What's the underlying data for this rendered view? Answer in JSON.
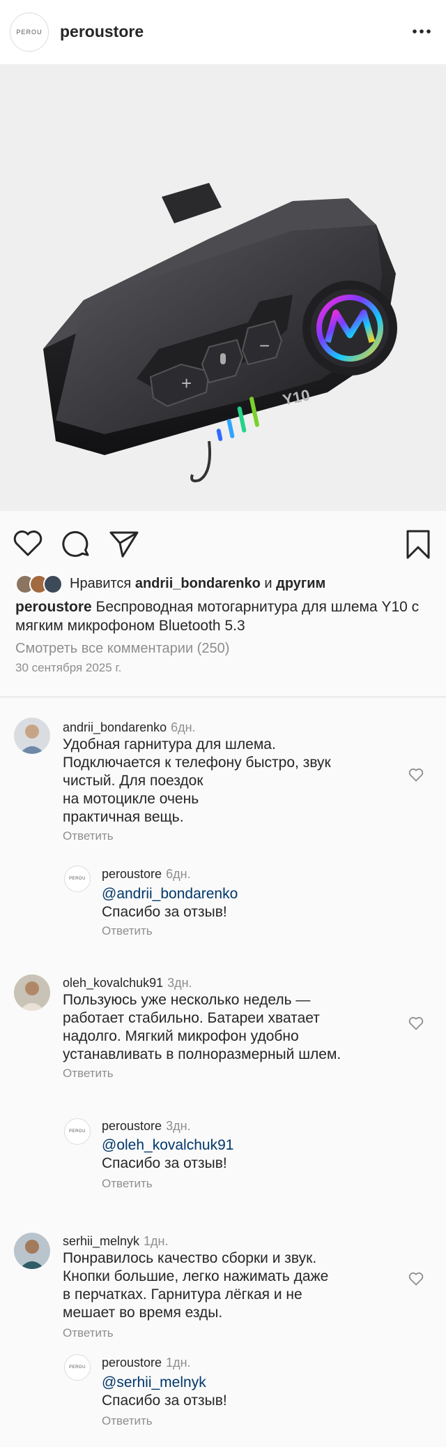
{
  "header": {
    "logo_text": "PEROU",
    "username": "peroustore"
  },
  "post": {
    "likes_prefix": "Нравится",
    "likes_user": "andrii_bondarenko",
    "likes_and": "и",
    "likes_others": "другим",
    "caption_user": "peroustore",
    "caption_text": "Беспроводная мотогарнитура для шлема Y10 с мягким микрофоном Bluetooth 5.3",
    "view_all": "Смотреть все комментарии (250)",
    "date": "30 сентября 2025 г.",
    "product_badge": "Y10"
  },
  "comments": [
    {
      "user": "andrii_bondarenko",
      "time": "6дн.",
      "lines": [
        "Удобная гарнитура для шлема.",
        "Подключается к телефону быстро, звук",
        "чистый. Для поездок",
        "на мотоцикле очень",
        "практичная вещь."
      ],
      "reply_label": "Ответить",
      "store_reply": {
        "user": "peroustore",
        "time": "6дн.",
        "mention": "@andrii_bondarenko",
        "text": "Спасибо за отзыв!",
        "reply_label": "Ответить"
      }
    },
    {
      "user": "oleh_kovalchuk91",
      "time": "3дн.",
      "lines": [
        "Пользуюсь уже несколько недель —",
        "работает стабильно. Батареи хватает",
        "надолго. Мягкий микрофон удобно",
        "устанавливать в полноразмерный шлем."
      ],
      "reply_label": "Ответить",
      "store_reply": {
        "user": "peroustore",
        "time": "3дн.",
        "mention": "@oleh_kovalchuk91",
        "text": "Спасибо за отзыв!",
        "reply_label": "Ответить"
      }
    },
    {
      "user": "serhii_melnyk",
      "time": "1дн.",
      "lines": [
        "Понравилось качество сборки и звук.",
        "Кнопки большие, легко нажимать даже",
        "в перчатках. Гарнитура лёгкая и не",
        "мешает во время езды."
      ],
      "reply_label": "Ответить",
      "store_reply": {
        "user": "peroustore",
        "time": "1дн.",
        "mention": "@serhii_melnyk",
        "text": "Спасибо за отзыв!",
        "reply_label": "Ответить"
      }
    }
  ],
  "icons": {
    "like": "heart-icon",
    "comment": "comment-icon",
    "share": "send-icon",
    "save": "bookmark-icon",
    "more": "more-icon"
  }
}
